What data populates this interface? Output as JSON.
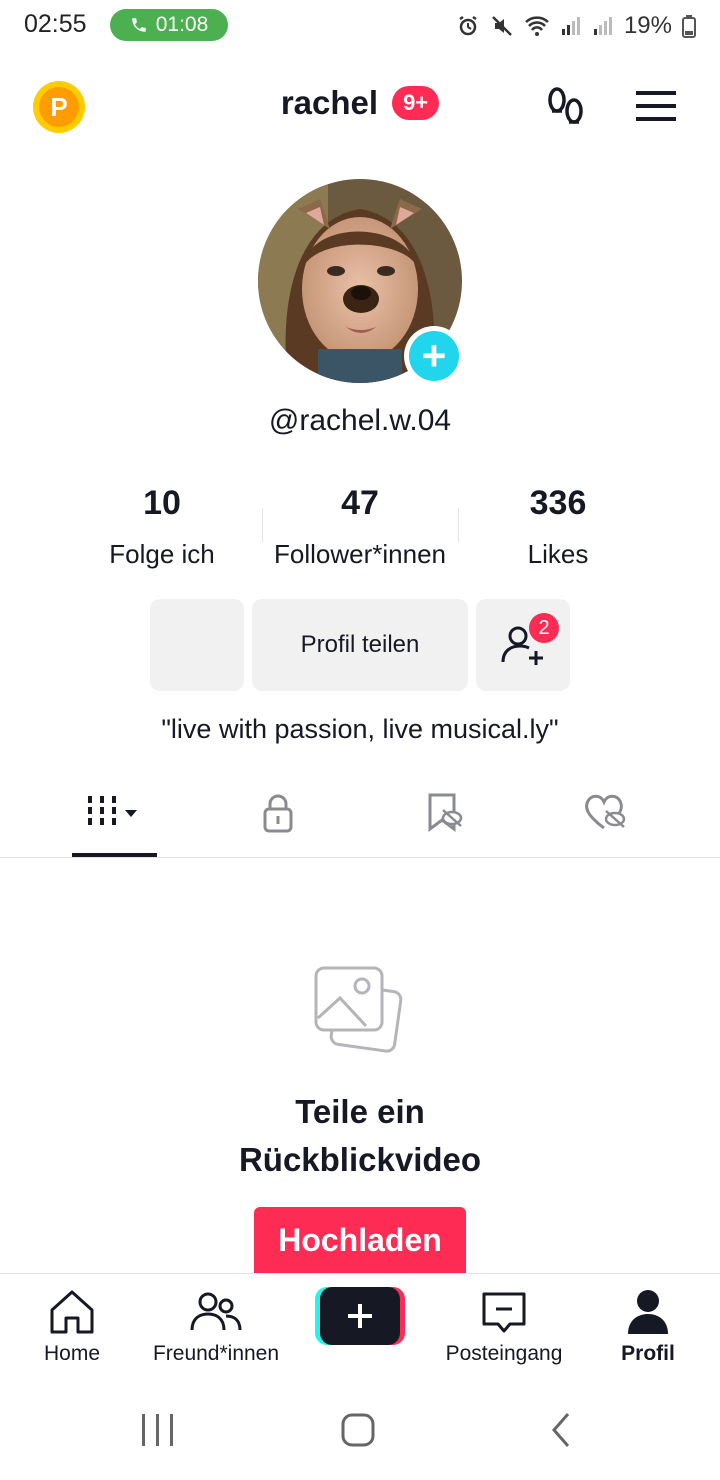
{
  "status_bar": {
    "time": "02:55",
    "call_timer": "01:08",
    "battery": "19%"
  },
  "header": {
    "username": "rachel",
    "notification_badge": "9+"
  },
  "profile": {
    "handle": "@rachel.w.04",
    "bio": "\"live with passion, live musical.ly\""
  },
  "stats": [
    {
      "value": "10",
      "label": "Folge ich"
    },
    {
      "value": "47",
      "label": "Follower*innen"
    },
    {
      "value": "336",
      "label": "Likes"
    }
  ],
  "actions": {
    "share_profile": "Profil teilen",
    "add_friends_badge": "2"
  },
  "empty_state": {
    "title_line1": "Teile ein",
    "title_line2": "Rückblickvideo",
    "upload_button": "Hochladen"
  },
  "bottom_nav": {
    "home": "Home",
    "friends": "Freund*innen",
    "inbox": "Posteingang",
    "profile": "Profil"
  },
  "colors": {
    "accent_red": "#fe2c55",
    "accent_cyan": "#20d5ec",
    "call_green": "#4caf50",
    "coin_yellow": "#ffcc00"
  }
}
